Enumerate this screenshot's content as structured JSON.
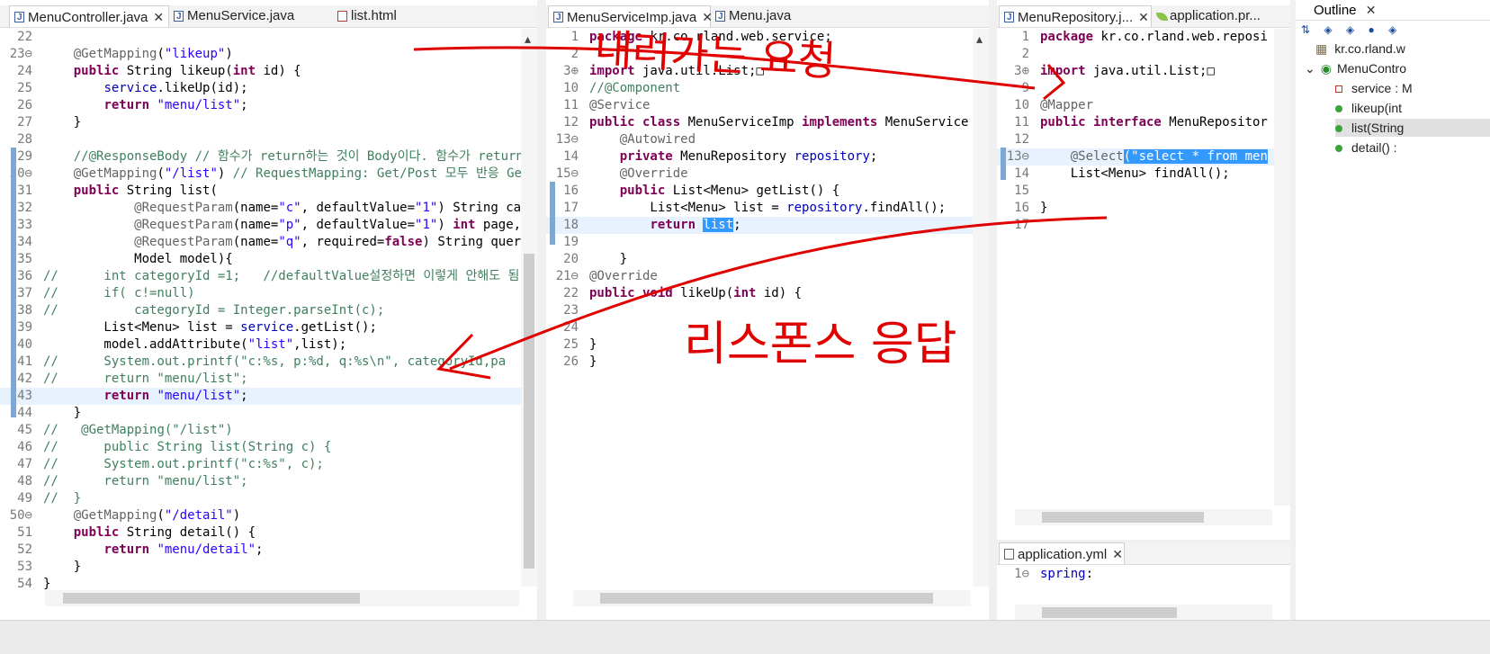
{
  "pane1": {
    "tabs": [
      {
        "label": "MenuController.java",
        "close": "✕",
        "icon": "java"
      },
      {
        "label": "MenuService.java",
        "icon": "java"
      },
      {
        "label": "list.html",
        "icon": "html"
      }
    ],
    "lines": [
      {
        "n": "22",
        "t": ""
      },
      {
        "n": "23⊖",
        "h": "    <span class=\"ann\">@GetMapping</span>(<span class=\"str\">\"likeup\"</span>)"
      },
      {
        "n": "24",
        "h": "    <span class=\"kw\">public</span> String likeup(<span class=\"kw\">int</span> id) {"
      },
      {
        "n": "25",
        "h": "        <span class=\"fld\">service</span>.likeUp(id);"
      },
      {
        "n": "26",
        "h": "        <span class=\"kw\">return</span> <span class=\"str\">\"menu/list\"</span>;"
      },
      {
        "n": "27",
        "t": "    }"
      },
      {
        "n": "28",
        "t": ""
      },
      {
        "n": "29",
        "h": "    <span class=\"cmt\">//@ResponseBody // 함수가 return하는 것이 Body이다. 함수가 return하</span>"
      },
      {
        "n": "30⊖",
        "h": "    <span class=\"ann\">@GetMapping</span>(<span class=\"str\">\"/list\"</span>) <span class=\"cmt\">// RequestMapping: Get/Post 모두 반응 Ge</span>"
      },
      {
        "n": "31",
        "h": "    <span class=\"kw\">public</span> String list("
      },
      {
        "n": "32",
        "h": "            <span class=\"ann\">@RequestParam</span>(name=<span class=\"str\">\"c\"</span>, defaultValue=<span class=\"str\">\"1\"</span>) String cat"
      },
      {
        "n": "33",
        "h": "            <span class=\"ann\">@RequestParam</span>(name=<span class=\"str\">\"p\"</span>, defaultValue=<span class=\"str\">\"1\"</span>) <span class=\"kw\">int</span> page,"
      },
      {
        "n": "34",
        "h": "            <span class=\"ann\">@RequestParam</span>(name=<span class=\"str\">\"q\"</span>, required=<span class=\"kw\">false</span>) String query"
      },
      {
        "n": "35",
        "t": "            Model model){"
      },
      {
        "n": "36",
        "h": "<span class=\"cmt\">//      int categoryId =1;   //defaultValue설정하면 이렇게 안해도 됨</span>"
      },
      {
        "n": "37",
        "h": "<span class=\"cmt\">//      if( c!=null)</span>"
      },
      {
        "n": "38",
        "h": "<span class=\"cmt\">//          categoryId = Integer.parseInt(c);</span>"
      },
      {
        "n": "39",
        "h": "        List&lt;Menu&gt; list = <span class=\"fld\">service</span>.getList();"
      },
      {
        "n": "40",
        "h": "        model.addAttribute(<span class=\"str\">\"list\"</span>,list);"
      },
      {
        "n": "41",
        "h": "<span class=\"cmt\">//      System.out.printf(\"c:%s, p:%d, q:%s\\n\", categoryId,pa</span>"
      },
      {
        "n": "42",
        "h": "<span class=\"cmt\">//      return \"menu/list\";</span>"
      },
      {
        "n": "43",
        "h": "        <span class=\"kw\">return</span> <span class=\"str\">\"menu/list\"</span>;",
        "cur": true
      },
      {
        "n": "44",
        "t": "    }"
      },
      {
        "n": "45",
        "h": "<span class=\"cmt\">//  </span> <span class=\"cmt\">@GetMapping(\"/list\")</span>"
      },
      {
        "n": "46",
        "h": "<span class=\"cmt\">//      public String list(String c) {</span>"
      },
      {
        "n": "47",
        "h": "<span class=\"cmt\">//      System.out.printf(\"c:%s\", c);</span>"
      },
      {
        "n": "48",
        "h": "<span class=\"cmt\">//      return \"menu/list\";</span>"
      },
      {
        "n": "49",
        "h": "<span class=\"cmt\">//  }</span>"
      },
      {
        "n": "50⊖",
        "h": "    <span class=\"ann\">@GetMapping</span>(<span class=\"str\">\"/detail\"</span>)"
      },
      {
        "n": "51",
        "h": "    <span class=\"kw\">public</span> String detail() {"
      },
      {
        "n": "52",
        "h": "        <span class=\"kw\">return</span> <span class=\"str\">\"menu/detail\"</span>;"
      },
      {
        "n": "53",
        "t": "    }"
      },
      {
        "n": "54",
        "t": "}"
      }
    ]
  },
  "pane2": {
    "tabs": [
      {
        "label": "MenuServiceImp.java",
        "close": "✕",
        "icon": "java"
      },
      {
        "label": "Menu.java",
        "icon": "java"
      }
    ],
    "lines": [
      {
        "n": "1",
        "h": "<span class=\"kw\">package</span> kr.co.rland.web.service;"
      },
      {
        "n": "2",
        "t": ""
      },
      {
        "n": "3⊕",
        "h": "<span class=\"kw\">import</span> java.util.List;□"
      },
      {
        "n": "10",
        "h": "<span class=\"cmt\">//@Component</span>"
      },
      {
        "n": "11",
        "h": "<span class=\"ann\">@Service</span>"
      },
      {
        "n": "12",
        "h": "<span class=\"kw\">public class</span> MenuServiceImp <span class=\"kw\">implements</span> MenuService"
      },
      {
        "n": "13⊖",
        "h": "    <span class=\"ann\">@Autowired</span>"
      },
      {
        "n": "14",
        "h": "    <span class=\"kw\">private</span> MenuRepository <span class=\"fld\">repository</span>;"
      },
      {
        "n": "15⊖",
        "h": "    <span class=\"ann\">@Override</span>"
      },
      {
        "n": "16",
        "h": "    <span class=\"kw\">public</span> List&lt;Menu&gt; getList() {"
      },
      {
        "n": "17",
        "h": "        List&lt;Menu&gt; list = <span class=\"fld\">repository</span>.findAll();"
      },
      {
        "n": "18",
        "h": "        <span class=\"kw\">return</span> <span class=\"hl\">list</span>;",
        "cur": true
      },
      {
        "n": "19",
        "t": ""
      },
      {
        "n": "20",
        "t": "    }"
      },
      {
        "n": "21⊖",
        "h": "<span class=\"ann\">@Override</span>"
      },
      {
        "n": "22",
        "h": "<span class=\"kw\">public void</span> likeUp(<span class=\"kw\">int</span> id) {"
      },
      {
        "n": "23",
        "t": ""
      },
      {
        "n": "24",
        "t": ""
      },
      {
        "n": "25",
        "t": "}"
      },
      {
        "n": "26",
        "t": "}"
      }
    ]
  },
  "pane3": {
    "tabs": [
      {
        "label": "MenuRepository.j...",
        "close": "✕",
        "icon": "java"
      },
      {
        "label": "application.pr...",
        "icon": "leaf"
      }
    ],
    "lines": [
      {
        "n": "1",
        "h": "<span class=\"kw\">package</span> kr.co.rland.web.reposi"
      },
      {
        "n": "2",
        "t": ""
      },
      {
        "n": "3⊕",
        "h": "<span class=\"kw\">import</span> java.util.List;□"
      },
      {
        "n": "9",
        "t": ""
      },
      {
        "n": "10",
        "h": "<span class=\"ann\">@Mapper</span>"
      },
      {
        "n": "11",
        "h": "<span class=\"kw\">public interface</span> MenuRepositor"
      },
      {
        "n": "12",
        "t": ""
      },
      {
        "n": "13⊖",
        "h": "    <span class=\"ann\">@Select</span><span class=\"hl2\">(\"select * from men</span>",
        "cur": true
      },
      {
        "n": "14",
        "t": "    List<Menu> findAll();"
      },
      {
        "n": "15",
        "t": ""
      },
      {
        "n": "16",
        "t": "}"
      },
      {
        "n": "17",
        "t": ""
      }
    ]
  },
  "pane4": {
    "tab": {
      "label": "application.yml",
      "close": "✕"
    },
    "lines": [
      {
        "n": "1⊖",
        "h": "<span class=\"fld\">spring</span>:"
      }
    ]
  },
  "outline": {
    "title": "Outline",
    "close": "✕",
    "items": [
      {
        "label": "kr.co.rland.w",
        "kind": "package"
      },
      {
        "label": "MenuContro",
        "kind": "class"
      },
      {
        "label": "service : M",
        "kind": "field"
      },
      {
        "label": "likeup(int",
        "kind": "method"
      },
      {
        "label": "list(String",
        "kind": "method",
        "selected": true
      },
      {
        "label": "detail() :",
        "kind": "method"
      }
    ]
  },
  "annotations": {
    "request": "내려가는 요청",
    "response": "리스폰스 응답"
  },
  "colors": {
    "ink": "#e00000",
    "selection": "#3399ff",
    "current_line": "#e8f2fe"
  }
}
